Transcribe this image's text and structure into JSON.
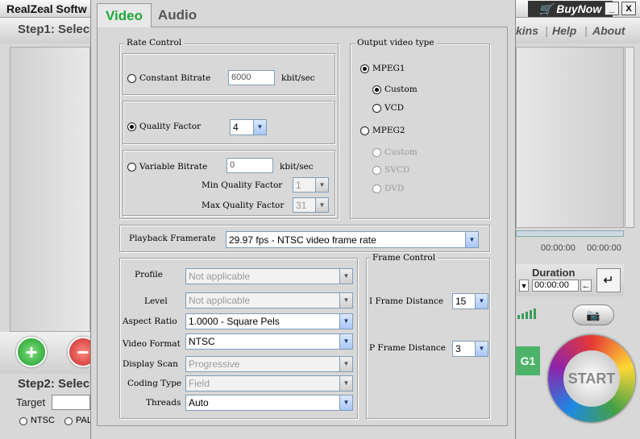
{
  "app": {
    "title": "RealZeal Softw",
    "buy_label": "BuyNow",
    "minimize": "_",
    "close": "X",
    "menu": [
      "kins",
      "Help",
      "About"
    ],
    "step1": "Step1: Selec",
    "step2": "Step2: Selec",
    "target_label": "Target",
    "ntsc": "NTSC",
    "pal": "PAL",
    "time_start": "00:00:00",
    "time_end": "00:00:00",
    "duration_label": "Duration",
    "duration_value": "00:00:00",
    "format_tab": "G1",
    "start_label": "START"
  },
  "dialog": {
    "tabs": [
      {
        "label": "Video",
        "active": true
      },
      {
        "label": "Audio",
        "active": false
      }
    ],
    "rate_control": {
      "title": "Rate Control",
      "constant_bitrate": {
        "label": "Constant Bitrate",
        "value": "6000",
        "unit": "kbit/sec",
        "selected": false
      },
      "quality_factor": {
        "label": "Quality Factor",
        "value": "4",
        "selected": true
      },
      "variable_bitrate": {
        "label": "Variable Bitrate",
        "value": "0",
        "unit": "kbit/sec",
        "selected": false
      },
      "min_quality": {
        "label": "Min Quality Factor",
        "value": "1"
      },
      "max_quality": {
        "label": "Max Quality Factor",
        "value": "31"
      }
    },
    "output_type": {
      "title": "Output video type",
      "mpeg1": "MPEG1",
      "custom1": "Custom",
      "vcd": "VCD",
      "mpeg2": "MPEG2",
      "custom2": "Custom",
      "svcd": "SVCD",
      "dvd": "DVD"
    },
    "playback": {
      "label": "Playback Framerate",
      "value": "29.97 fps - NTSC video frame rate"
    },
    "settings": {
      "profile": {
        "label": "Profile",
        "value": "Not applicable"
      },
      "level": {
        "label": "Level",
        "value": "Not applicable"
      },
      "aspect": {
        "label": "Aspect Ratio",
        "value": "1.0000 - Square Pels"
      },
      "format": {
        "label": "Video Format",
        "value": "NTSC"
      },
      "scan": {
        "label": "Display Scan",
        "value": "Progressive"
      },
      "coding": {
        "label": "Coding Type",
        "value": "Field"
      },
      "threads": {
        "label": "Threads",
        "value": "Auto"
      }
    },
    "frame_control": {
      "title": "Frame Control",
      "i_frame": {
        "label": "I Frame Distance",
        "value": "15"
      },
      "p_frame": {
        "label": "P Frame Distance",
        "value": "3"
      }
    },
    "icons": {
      "dropdown": "▼",
      "spin_down": "▼"
    }
  }
}
